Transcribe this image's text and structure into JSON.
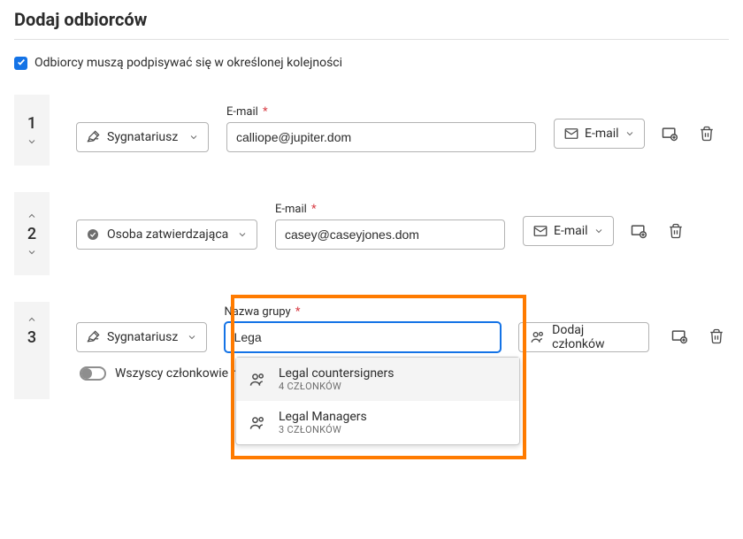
{
  "title": "Dodaj odbiorców",
  "order_checkbox_label": "Odbiorcy muszą podpisywać się w określonej kolejności",
  "email_label": "E-mail",
  "group_label": "Nazwa grupy",
  "required_mark": "*",
  "delivery_label": "E-mail",
  "add_members_label": "Dodaj członków",
  "all_members_label": "Wszyscy członkowie mu",
  "recipients": [
    {
      "num": "1",
      "role": "Sygnatariusz",
      "email": "calliope@jupiter.dom"
    },
    {
      "num": "2",
      "role": "Osoba zatwierdzająca",
      "email": "casey@caseyjones.dom"
    },
    {
      "num": "3",
      "role": "Sygnatariusz",
      "group_value": "Lega"
    }
  ],
  "dropdown": [
    {
      "name": "Legal countersigners",
      "count": "4 CZŁONKÓW"
    },
    {
      "name": "Legal Managers",
      "count": "3 CZŁONKÓW"
    }
  ]
}
